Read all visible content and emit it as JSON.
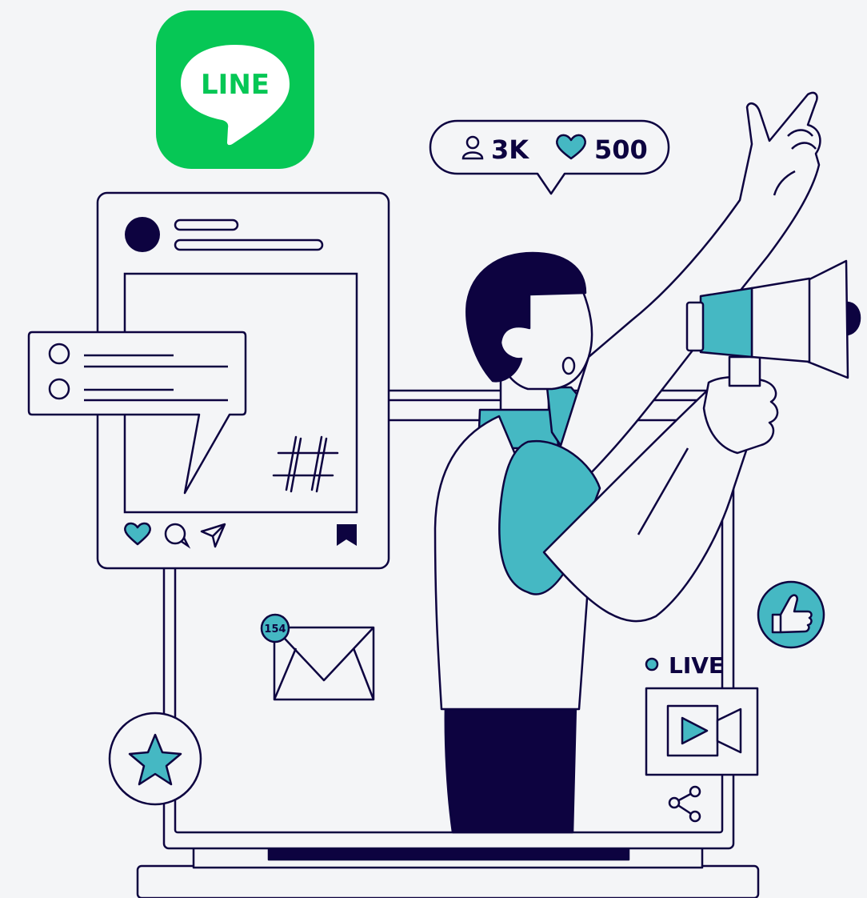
{
  "app_icon": {
    "brand": "LINE",
    "label": "LINE",
    "bg_color": "#06C755"
  },
  "stats_bubble": {
    "followers": "3K",
    "likes": "500"
  },
  "notifications": {
    "mail_count": "154"
  },
  "live": {
    "label": "LIVE"
  },
  "colors": {
    "navy": "#0d0340",
    "teal": "#45b8c3",
    "line_green": "#06C755",
    "background": "#f4f5f7",
    "panel": "#f4f5f7"
  },
  "icons": [
    "line-logo-icon",
    "user-icon",
    "heart-icon",
    "comment-icon",
    "send-icon",
    "bookmark-icon",
    "hashtag-icon",
    "mail-icon",
    "star-icon",
    "thumbs-up-icon",
    "video-icon",
    "share-icon",
    "megaphone-icon"
  ]
}
